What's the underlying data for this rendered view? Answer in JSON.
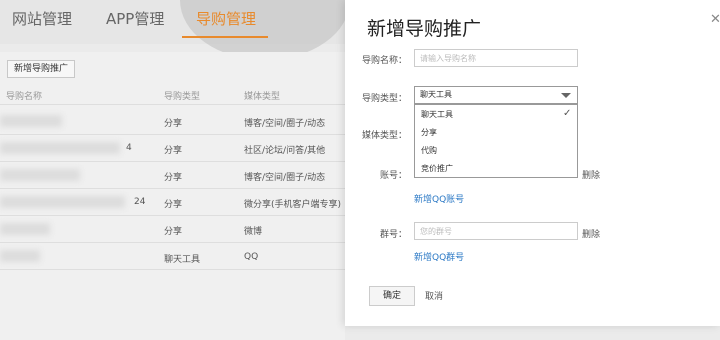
{
  "nav": {
    "tabs": [
      {
        "label": "网站管理"
      },
      {
        "label": "APP管理"
      },
      {
        "label": "导购管理"
      }
    ]
  },
  "list": {
    "add_button": "新增导购推广",
    "headers": [
      "导购名称",
      "导购类型",
      "媒体类型"
    ],
    "rows": [
      {
        "name": "",
        "type": "分享",
        "media": "博客/空间/圈子/动态"
      },
      {
        "name": "4",
        "type": "分享",
        "media": "社区/论坛/问答/其他"
      },
      {
        "name": "",
        "type": "分享",
        "media": "博客/空间/圈子/动态"
      },
      {
        "name": "24",
        "type": "分享",
        "media": "微分享(手机客户端专享)"
      },
      {
        "name": "",
        "type": "分享",
        "media": "微博"
      },
      {
        "name": "",
        "type": "聊天工具",
        "media": "QQ"
      }
    ]
  },
  "modal": {
    "title": "新增导购推广",
    "name_label": "导购名称：",
    "name_placeholder": "请输入导购名称",
    "type_label": "导购类型：",
    "type_value": "聊天工具",
    "type_options": [
      "聊天工具",
      "分享",
      "代购",
      "竞价推广"
    ],
    "media_label": "媒体类型：",
    "account_label": "账号：",
    "account_delete": "删除",
    "add_qq_account": "新增QQ账号",
    "group_label": "群号：",
    "group_placeholder": "您的群号",
    "group_delete": "删除",
    "add_qq_group": "新增QQ群号",
    "confirm": "确定",
    "cancel": "取消"
  }
}
